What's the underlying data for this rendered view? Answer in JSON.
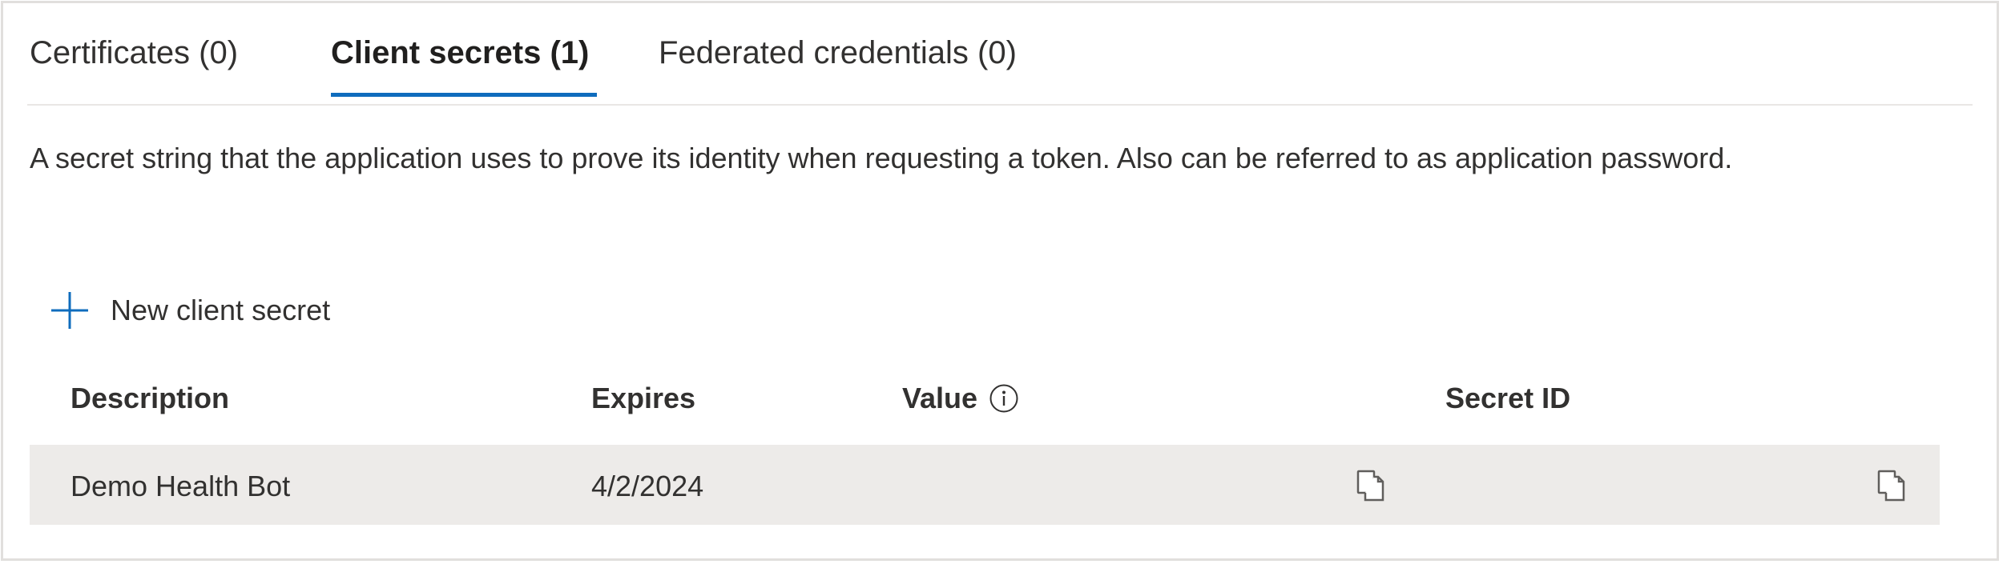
{
  "tabs": [
    {
      "label": "Certificates (0)",
      "active": false
    },
    {
      "label": "Client secrets (1)",
      "active": true
    },
    {
      "label": "Federated credentials (0)",
      "active": false
    }
  ],
  "description": "A secret string that the application uses to prove its identity when requesting a token. Also can be referred to as application password.",
  "toolbar": {
    "new_secret_label": "New client secret",
    "icon": "plus-icon"
  },
  "table": {
    "columns": [
      "Description",
      "Expires",
      "Value",
      "Secret ID"
    ],
    "value_info_icon": "info-icon",
    "rows": [
      {
        "description": "Demo Health Bot",
        "expires": "4/2/2024",
        "value": "",
        "secret_id": "",
        "copy_icon": "copy-icon"
      }
    ]
  },
  "colors": {
    "accent": "#0f6cbd",
    "row_background": "#edebe9",
    "border": "#e1dfdd",
    "text": "#323130"
  }
}
